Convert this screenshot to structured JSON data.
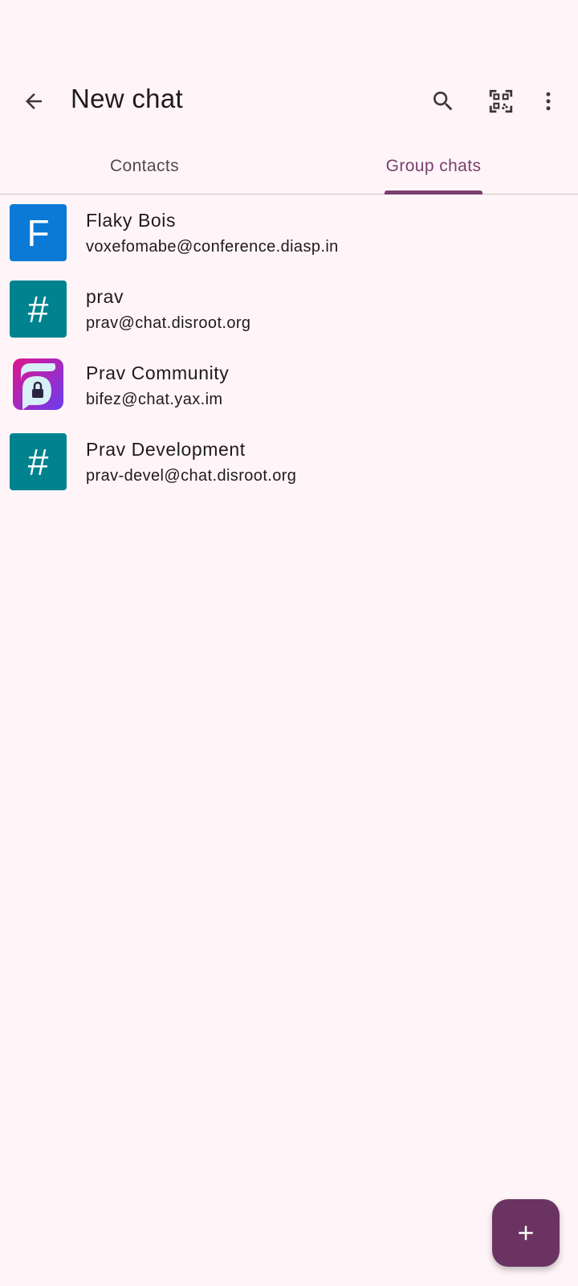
{
  "app_bar": {
    "title": "New chat",
    "back_icon": "arrow-back-icon",
    "search_icon": "search-icon",
    "qr_icon": "qr-code-scan-icon",
    "more_icon": "more-vert-icon"
  },
  "tabs": [
    {
      "label": "Contacts",
      "selected": false
    },
    {
      "label": "Group chats",
      "selected": true
    }
  ],
  "groups": [
    {
      "name": "Flaky Bois",
      "jid": "voxefomabe@conference.diasp.in",
      "avatar_letter": "F",
      "avatar_color": "#0a7ad6"
    },
    {
      "name": "prav",
      "jid": "prav@chat.disroot.org",
      "avatar_letter": "#",
      "avatar_color": "#00838f"
    },
    {
      "name": "Prav Community",
      "jid": "bifez@chat.yax.im",
      "avatar_letter": "",
      "avatar_color": "#8e2de2"
    },
    {
      "name": "Prav Development",
      "jid": "prav-devel@chat.disroot.org",
      "avatar_letter": "#",
      "avatar_color": "#00838f"
    }
  ],
  "fab": {
    "icon": "add-icon"
  },
  "colors": {
    "background": "#fff5f8",
    "accent": "#7a3f6e",
    "fab": "#6b3362"
  }
}
